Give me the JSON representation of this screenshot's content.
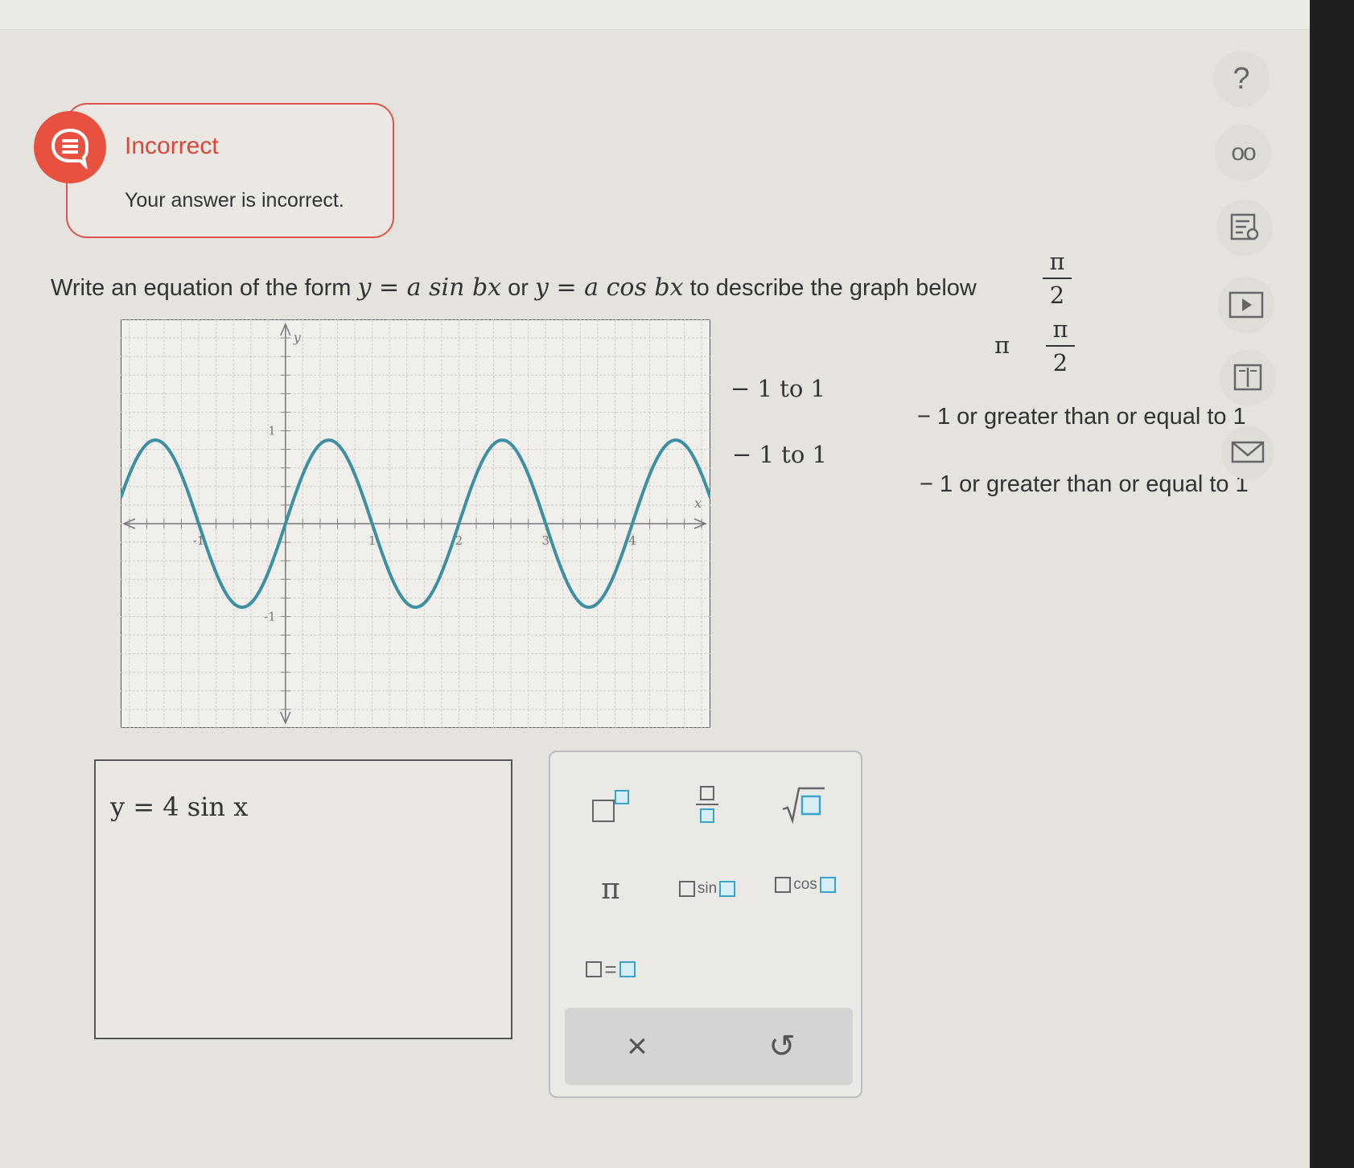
{
  "feedback": {
    "title": "Incorrect",
    "message": "Your answer is incorrect."
  },
  "question": {
    "prefix": "Write an equation of the form",
    "eq1": "y = a sin bx",
    "or": "or",
    "eq2": "y = a cos bx",
    "suffix": "to describe the graph below"
  },
  "overlay": {
    "pi_num_1": "π",
    "pi_den_1": "2",
    "pi_2": "π",
    "pi_num_3": "π",
    "pi_den_3": "2",
    "range_1": "− 1 to 1",
    "range_2": "− 1 to 1",
    "ge_1": "− 1 or greater than or equal to 1",
    "ge_2": "− 1 or greater than or equal to 1"
  },
  "graph": {
    "axis_x_label": "x",
    "axis_y_label": "y",
    "x_ticks": [
      "-1",
      "1",
      "2",
      "3",
      "4"
    ],
    "y_ticks": [
      "1",
      "-1"
    ],
    "curve_color": "#3d8fa3"
  },
  "chart_data": {
    "type": "line",
    "xlabel": "x",
    "ylabel": "y",
    "xlim": [
      -1.9,
      4.9
    ],
    "ylim": [
      -2.2,
      2.2
    ],
    "xticks": [
      -1,
      1,
      2,
      3,
      4
    ],
    "yticks": [
      1,
      -1
    ],
    "grid": true,
    "series": [
      {
        "function": "y = 0.9 sin(πx)",
        "amplitude": 0.9,
        "period": 2,
        "x_range": [
          -1.9,
          4.9
        ]
      }
    ]
  },
  "answer": {
    "value": "y = 4 sin x"
  },
  "palette": {
    "pi": "π",
    "sin": "sin",
    "cos": "cos",
    "equals": "=",
    "clear": "×",
    "undo": "↺"
  },
  "toolbar": {
    "help": "?",
    "glasses": "oo"
  },
  "colors": {
    "error": "#e0524a",
    "accent": "#3aa3c9"
  }
}
